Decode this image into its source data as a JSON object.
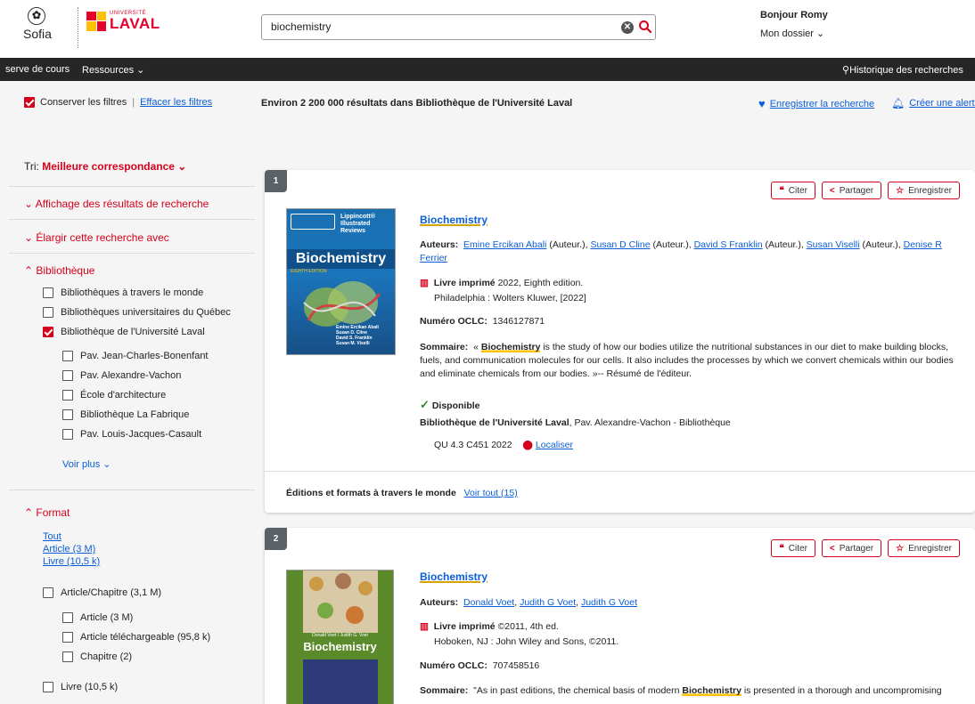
{
  "header": {
    "sofia_label": "Sofia",
    "ul_small": "UNIVERSITÉ",
    "ul_big": "LAVAL",
    "search_value": "biochemistry",
    "greeting": "Bonjour Romy",
    "account_menu": "Mon dossier"
  },
  "nav": {
    "items": [
      "serve de cours",
      "Ressources"
    ],
    "history": "Historique des recherches"
  },
  "filterbar": {
    "keep_filters": "Conserver les filtres",
    "clear_filters": "Effacer les filtres",
    "result_count": "Environ 2 200 000 résultats dans Bibliothèque de l'Université Laval",
    "save_search": "Enregistrer la recherche",
    "create_alert": "Créer une alerte"
  },
  "sidebar": {
    "sort_label": "Tri:",
    "sort_value": "Meilleure correspondance",
    "sections": {
      "display": "Affichage des résultats de recherche",
      "expand": "Élargir cette recherche avec",
      "library": "Bibliothèque",
      "format": "Format"
    },
    "libraries": [
      {
        "label": "Bibliothèques à travers le monde",
        "checked": false
      },
      {
        "label": "Bibliothèques universitaires du Québec",
        "checked": false
      },
      {
        "label": "Bibliothèque de l'Université Laval",
        "checked": true
      }
    ],
    "branches": [
      "Pav. Jean-Charles-Bonenfant",
      "Pav. Alexandre-Vachon",
      "École d'architecture",
      "Bibliothèque La Fabrique",
      "Pav. Louis-Jacques-Casault"
    ],
    "see_more": "Voir plus",
    "format_links": [
      "Tout",
      "Article (3 M)",
      "Livre (10,5 k)"
    ],
    "format_opts": {
      "article_chapter": "Article/Chapitre (3,1 M)",
      "article": "Article (3 M)",
      "downloadable": "Article téléchargeable (95,8 k)",
      "chapter": "Chapitre (2)",
      "book": "Livre (10,5 k)"
    }
  },
  "actions": {
    "cite": "Citer",
    "share": "Partager",
    "save": "Enregistrer"
  },
  "results": [
    {
      "number": "1",
      "title": "Biochemistry",
      "authors_label": "Auteurs:",
      "authors": [
        "Emine Ercikan Abali",
        "Susan D Cline",
        "David S Franklin",
        "Susan Viselli",
        "Denise R Ferrier"
      ],
      "role": "(Auteur.),",
      "format": "Livre imprimé",
      "edition": "2022, Eighth edition.",
      "publisher": "Philadelphia : Wolters Kluwer, [2022]",
      "oclc_label": "Numéro OCLC:",
      "oclc": "1346127871",
      "summary_label": "Sommaire:",
      "summary_pre": "«",
      "summary_hl": "Biochemistry",
      "summary_post": "is the study of how our bodies utilize the nutritional substances in our diet to make building blocks, fuels, and communication molecules for our cells. It also includes the processes by which we convert chemicals within our bodies and eliminate chemicals from our bodies. »-- Résumé de l'éditeur.",
      "availability": "Disponible",
      "location_bold": "Bibliothèque de l'Université Laval",
      "location_rest": ", Pav. Alexandre-Vachon - Bibliothèque",
      "call_number": "QU 4.3 C451 2022",
      "locate": "Localiser",
      "editions_label": "Éditions et formats à travers le monde",
      "editions_link": "Voir tout (15)",
      "cover": {
        "lines": [
          "Lippincott®",
          "Illustrated",
          "Reviews"
        ],
        "title": "Biochemistry",
        "edition": "EIGHTH EDITION",
        "authors": [
          "Emine Ercikan Abali",
          "Susan D. Cline",
          "David S. Franklin",
          "Susan M. Viselli"
        ]
      }
    },
    {
      "number": "2",
      "title": "Biochemistry",
      "authors_label": "Auteurs:",
      "authors": [
        "Donald Voet",
        "Judith G Voet",
        "Judith G Voet"
      ],
      "format": "Livre imprimé",
      "edition": "©2011, 4th ed.",
      "publisher": "Hoboken, NJ : John Wiley and Sons, ©2011.",
      "oclc_label": "Numéro OCLC:",
      "oclc": "707458516",
      "summary_label": "Sommaire:",
      "summary_pre": "\"As in past editions, the chemical basis of modern",
      "summary_hl": "Biochemistry",
      "summary_post": "is presented in a thorough and uncompromising",
      "cover": {
        "authors_line": "Donald Voet / Judith G. Voet",
        "title": "Biochemistry"
      }
    }
  ],
  "colors": {
    "accent": "#d6001c",
    "link": "#0b5ed7",
    "highlight": "#ffc103",
    "nav": "#262626"
  }
}
